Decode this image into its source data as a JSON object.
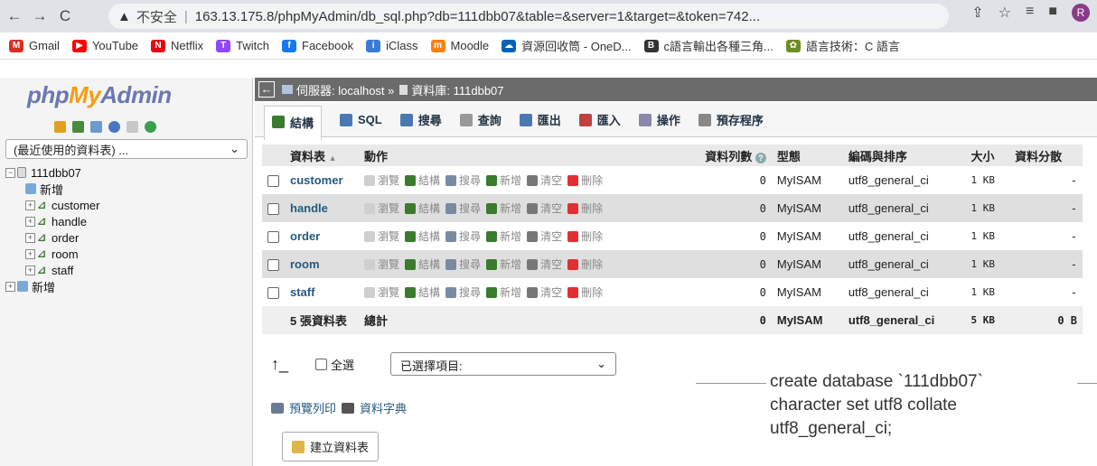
{
  "browser": {
    "back": "←",
    "forward": "→",
    "reload": "C",
    "warning": "▲",
    "insecure": "不安全",
    "url": "163.13.175.8/phpMyAdmin/db_sql.php?db=111dbb07&table=&server=1&target=&token=742...",
    "profile": "R"
  },
  "bookmarks": [
    {
      "label": "Gmail",
      "icon": "gmail-icon",
      "color": "#d93025",
      "glyph": "M"
    },
    {
      "label": "YouTube",
      "icon": "youtube-icon",
      "color": "#ff0000",
      "glyph": "▶"
    },
    {
      "label": "Netflix",
      "icon": "netflix-icon",
      "color": "#e50914",
      "glyph": "N"
    },
    {
      "label": "Twitch",
      "icon": "twitch-icon",
      "color": "#9146ff",
      "glyph": "T"
    },
    {
      "label": "Facebook",
      "icon": "facebook-icon",
      "color": "#1877f2",
      "glyph": "f"
    },
    {
      "label": "iClass",
      "icon": "iclass-icon",
      "color": "#3a7bd5",
      "glyph": "i"
    },
    {
      "label": "Moodle",
      "icon": "moodle-icon",
      "color": "#f98012",
      "glyph": "m"
    },
    {
      "label": "資源回收筒 - OneD...",
      "icon": "onedrive-icon",
      "color": "#0364b8",
      "glyph": "☁"
    },
    {
      "label": "c語言輸出各種三角...",
      "icon": "blog-icon",
      "color": "#333333",
      "glyph": "B"
    },
    {
      "label": "語言技術：C 語言",
      "icon": "leaf-icon",
      "color": "#6b8e23",
      "glyph": "✿"
    }
  ],
  "sidebar": {
    "logo_php": "php",
    "logo_my": "My",
    "logo_admin": "Admin",
    "db_select": "(最近使用的資料表) ...",
    "tree": {
      "db": "111dbb07",
      "new_in_db": "新增",
      "tables": [
        "customer",
        "handle",
        "order",
        "room",
        "staff"
      ],
      "new_root": "新增"
    }
  },
  "breadcrumb": {
    "server_label": "伺服器: localhost »",
    "db_label": "資料庫: 111dbb07"
  },
  "tabs": [
    {
      "label": "結構",
      "icon": "structure-icon",
      "color": "#3a7b2e"
    },
    {
      "label": "SQL",
      "icon": "sql-icon",
      "color": "#4a78b0"
    },
    {
      "label": "搜尋",
      "icon": "search-icon",
      "color": "#4a78b0"
    },
    {
      "label": "查詢",
      "icon": "query-icon",
      "color": "#999999"
    },
    {
      "label": "匯出",
      "icon": "export-icon",
      "color": "#4a78b0"
    },
    {
      "label": "匯入",
      "icon": "import-icon",
      "color": "#c04040"
    },
    {
      "label": "操作",
      "icon": "wrench-icon",
      "color": "#8888aa"
    },
    {
      "label": "預存程序",
      "icon": "routines-icon",
      "color": "#888888"
    }
  ],
  "table": {
    "headers": {
      "table": "資料表",
      "table_sort": "▲",
      "action": "動作",
      "rows": "資料列數",
      "rows_help": "?",
      "type": "型態",
      "collation": "編碼與排序",
      "size": "大小",
      "overhead": "資料分散"
    },
    "actions": [
      {
        "label": "瀏覽",
        "icon": "browse-icon",
        "color": "#cfcfcf"
      },
      {
        "label": "結構",
        "icon": "structure-icon",
        "color": "#3a7b2e"
      },
      {
        "label": "搜尋",
        "icon": "search-icon",
        "color": "#7a8aa0"
      },
      {
        "label": "新增",
        "icon": "insert-icon",
        "color": "#3a7b2e"
      },
      {
        "label": "清空",
        "icon": "empty-icon",
        "color": "#777777"
      },
      {
        "label": "刪除",
        "icon": "drop-icon",
        "color": "#e03030"
      }
    ],
    "rows": [
      {
        "name": "customer",
        "rows": "0",
        "type": "MyISAM",
        "collation": "utf8_general_ci",
        "size": "1 KB",
        "overhead": "-"
      },
      {
        "name": "handle",
        "rows": "0",
        "type": "MyISAM",
        "collation": "utf8_general_ci",
        "size": "1 KB",
        "overhead": "-"
      },
      {
        "name": "order",
        "rows": "0",
        "type": "MyISAM",
        "collation": "utf8_general_ci",
        "size": "1 KB",
        "overhead": "-"
      },
      {
        "name": "room",
        "rows": "0",
        "type": "MyISAM",
        "collation": "utf8_general_ci",
        "size": "1 KB",
        "overhead": "-"
      },
      {
        "name": "staff",
        "rows": "0",
        "type": "MyISAM",
        "collation": "utf8_general_ci",
        "size": "1 KB",
        "overhead": "-"
      }
    ],
    "summary": {
      "count": "5 張資料表",
      "label": "總計",
      "rows": "0",
      "type": "MyISAM",
      "collation": "utf8_general_ci",
      "size": "5 KB",
      "overhead": "0 B"
    }
  },
  "bottom": {
    "check_all": "全選",
    "with_selected": "已選擇項目:",
    "print_view": "預覽列印",
    "data_dict": "資料字典",
    "create_table": "建立資料表"
  },
  "overlay_text": "create database `111dbb07`\ncharacter set utf8 collate\nutf8_general_ci;"
}
